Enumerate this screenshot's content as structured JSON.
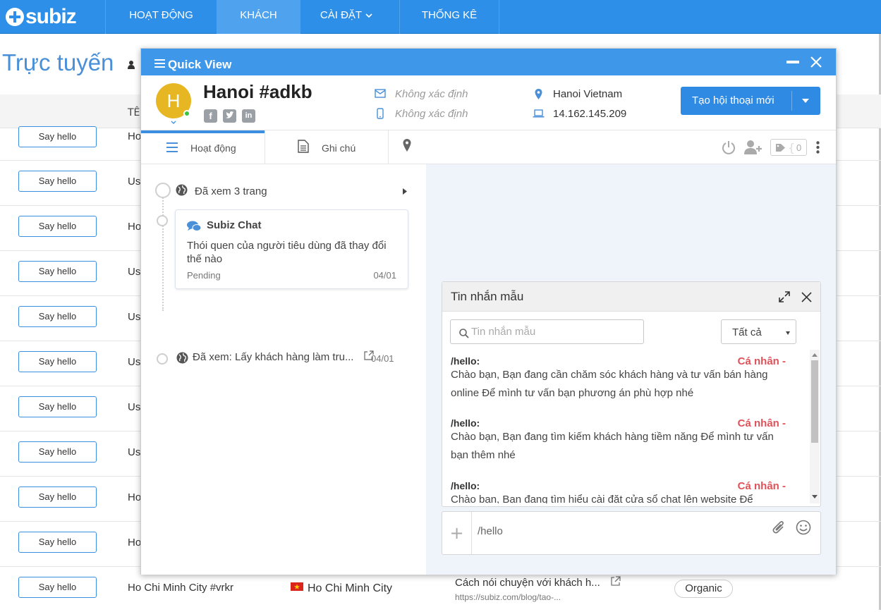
{
  "app": {
    "logo": "subiz"
  },
  "nav": {
    "items": [
      {
        "label": "HOẠT ĐỘNG"
      },
      {
        "label": "KHÁCH"
      },
      {
        "label": "CÀI ĐẶT"
      },
      {
        "label": "THỐNG KÊ"
      }
    ],
    "active": "KHÁCH"
  },
  "page": {
    "title": "Trực tuyến",
    "column_name": "TÊ"
  },
  "rows": [
    {
      "button": "Say hello",
      "name": "Ho"
    },
    {
      "button": "Say hello",
      "name": "Us"
    },
    {
      "button": "Say hello",
      "name": "Ho"
    },
    {
      "button": "Say hello",
      "name": "Us"
    },
    {
      "button": "Say hello",
      "name": "Us"
    },
    {
      "button": "Say hello",
      "name": "Us"
    },
    {
      "button": "Say hello",
      "name": "Us"
    },
    {
      "button": "Say hello",
      "name": "Us"
    },
    {
      "button": "Say hello",
      "name": "Ho"
    },
    {
      "button": "Say hello",
      "name": "Ho"
    },
    {
      "button": "Say hello",
      "name": "Ho Chi Minh City #vrkr"
    }
  ],
  "last_row": {
    "city": "Ho Chi Minh City",
    "page_title": "Cách nói chuyện với khách h...",
    "page_url": "https://subiz.com/blog/tao-...",
    "source": "Organic"
  },
  "quickview": {
    "title": "Quick View",
    "avatar_letter": "H",
    "customer_name": "Hanoi #adkb",
    "email": "Không xác định",
    "phone": "Không xác định",
    "location": "Hanoi Vietnam",
    "ip": "14.162.145.209",
    "new_conversation": "Tạo hội thoại mới",
    "tabs": {
      "activity": "Hoạt động",
      "notes": "Ghi chú"
    },
    "tag_count": "0",
    "activities": {
      "viewed_pages": "Đã xem 3 trang",
      "chat_title": "Subiz Chat",
      "chat_body": "Thói quen của người tiêu dùng đã thay đổi thế nào",
      "chat_status": "Pending",
      "chat_date": "04/01",
      "viewed_page": "Đã xem: Lấy khách hàng làm tru...",
      "viewed_date": "04/01"
    },
    "templates": {
      "title": "Tin nhắn mẫu",
      "search_placeholder": "Tin nhắn mẫu",
      "filter": "Tất cả",
      "items": [
        {
          "code": "/hello:",
          "owner": "Cá nhân -",
          "text": "Chào bạn, Bạn đang cần chăm sóc khách hàng và tư vấn bán hàng online Để mình tư vấn bạn phương án phù hợp nhé"
        },
        {
          "code": "/hello:",
          "owner": "Cá nhân -",
          "text": "Chào bạn, Bạn đang tìm kiếm khách hàng tiềm năng Để mình tư vấn bạn thêm nhé"
        },
        {
          "code": "/hello:",
          "owner": "Cá nhân -",
          "text": "Chào bạn, Bạn đang tìm hiểu cài đặt cửa sổ chat lên website Để"
        }
      ]
    },
    "composer": {
      "value": "/hello"
    }
  },
  "colors": {
    "primary": "#2d8fe8",
    "accent_red": "#e0525a",
    "avatar": "#e6b722"
  }
}
